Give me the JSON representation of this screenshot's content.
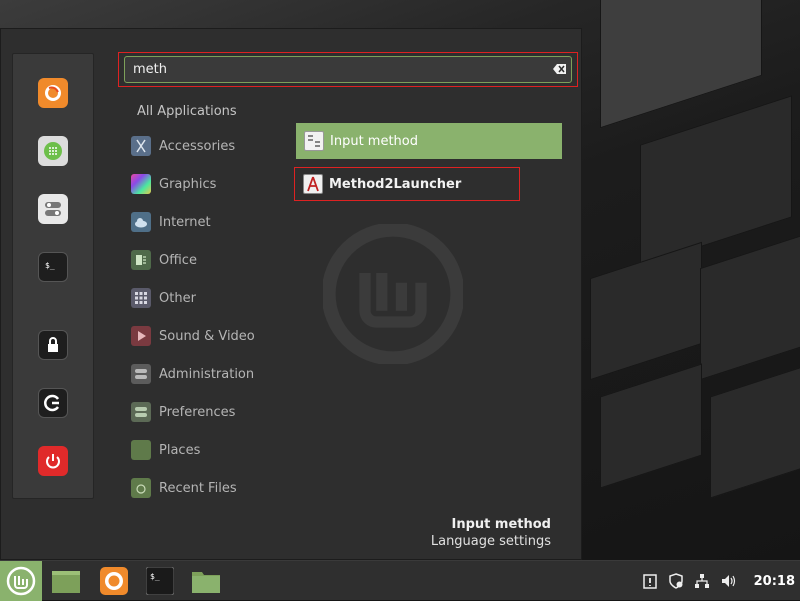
{
  "search": {
    "value": "meth"
  },
  "categories": [
    {
      "label": "All Applications"
    },
    {
      "label": "Accessories"
    },
    {
      "label": "Graphics"
    },
    {
      "label": "Internet"
    },
    {
      "label": "Office"
    },
    {
      "label": "Other"
    },
    {
      "label": "Sound & Video"
    },
    {
      "label": "Administration"
    },
    {
      "label": "Preferences"
    },
    {
      "label": "Places"
    },
    {
      "label": "Recent Files"
    }
  ],
  "results": [
    {
      "label": "Input method",
      "icon": "input-method-icon"
    },
    {
      "label": "Method2Launcher",
      "icon": "method2launcher-icon"
    }
  ],
  "description": {
    "title": "Input method",
    "subtitle": "Language settings"
  },
  "panel": {
    "clock": "20:18"
  },
  "colors": {
    "accent": "#8ab26d",
    "highlight_border": "#dd2222"
  }
}
